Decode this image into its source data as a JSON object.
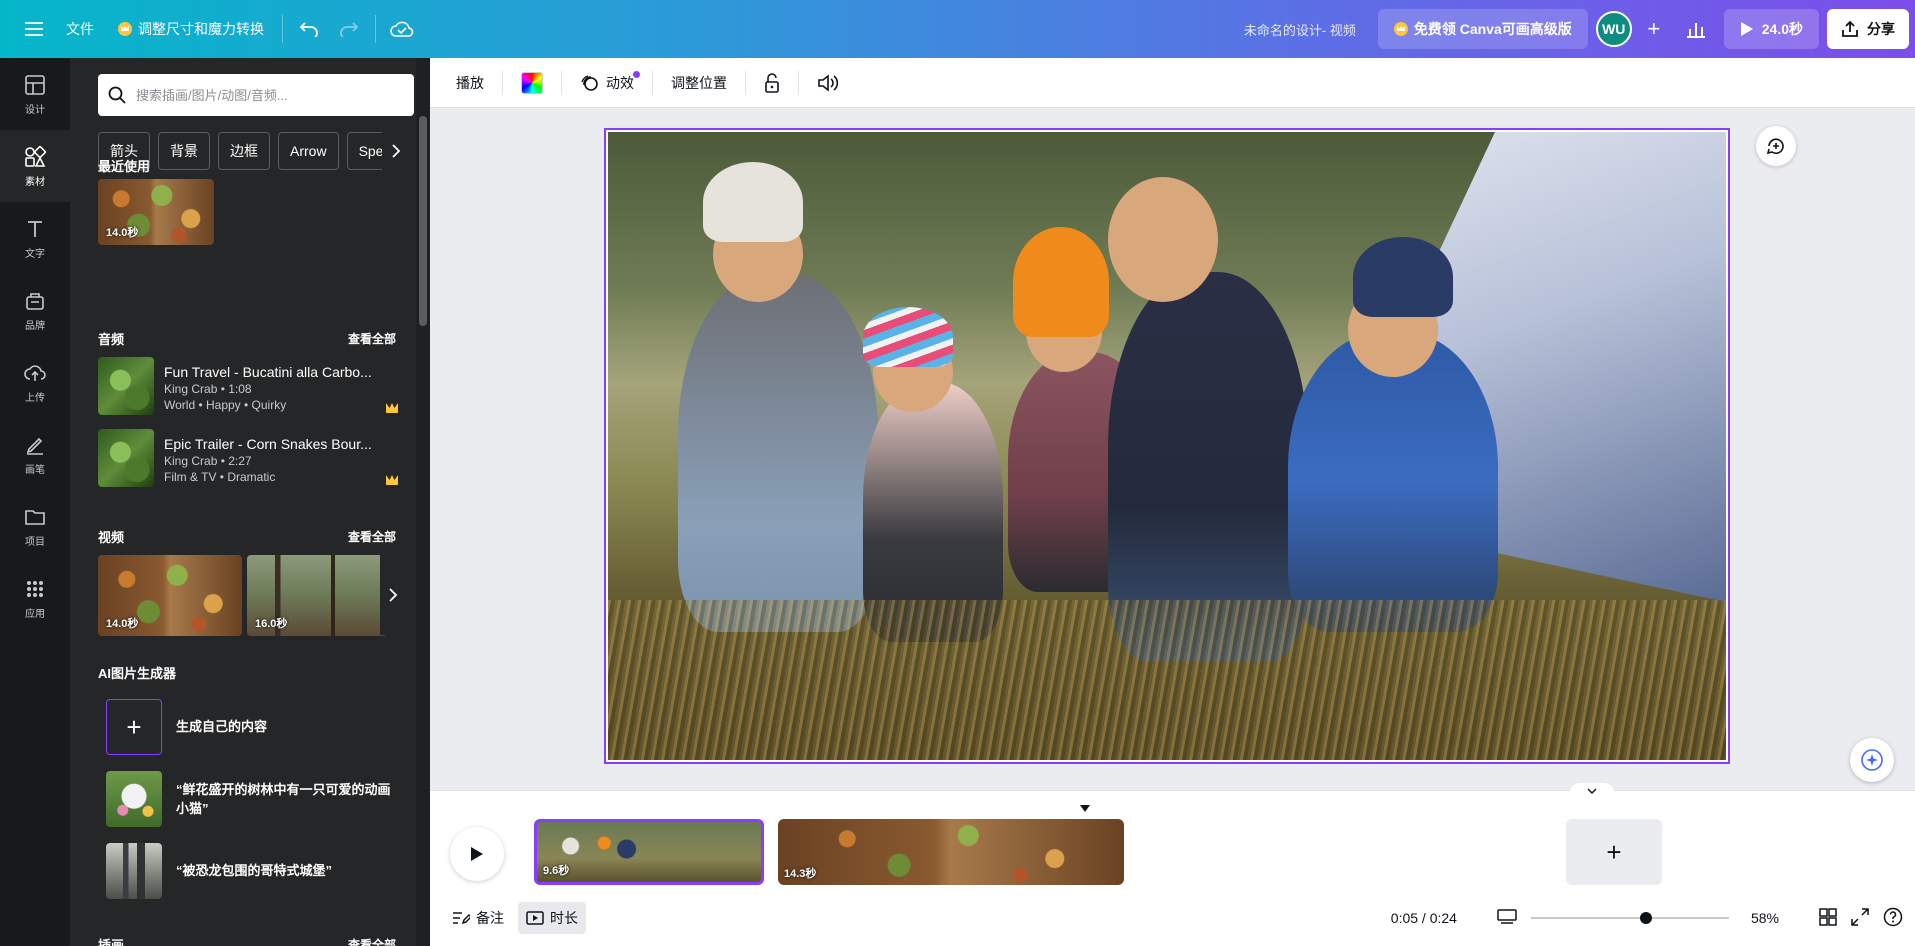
{
  "topbar": {
    "menu_icon": "hamburger-icon",
    "file_label": "文件",
    "resize_label": "调整尺寸和魔力转换",
    "design_name": "未命名的设计- 视频",
    "upgrade_label": "免费领 Canva可画高级版",
    "avatar_initials": "WU",
    "play_duration": "24.0秒",
    "share_label": "分享"
  },
  "rail": {
    "items": [
      {
        "label": "设计",
        "icon": "layout-icon"
      },
      {
        "label": "素材",
        "icon": "shapes-icon"
      },
      {
        "label": "文字",
        "icon": "text-icon"
      },
      {
        "label": "品牌",
        "icon": "brand-icon"
      },
      {
        "label": "上传",
        "icon": "upload-icon"
      },
      {
        "label": "画笔",
        "icon": "draw-icon"
      },
      {
        "label": "项目",
        "icon": "folder-icon"
      },
      {
        "label": "应用",
        "icon": "apps-icon"
      }
    ]
  },
  "panel": {
    "search_placeholder": "搜索插画/图片/动图/音频...",
    "chips": [
      "箭头",
      "背景",
      "边框",
      "Arrow",
      "Spe"
    ],
    "recent": {
      "title": "最近使用",
      "items": [
        {
          "duration": "14.0秒"
        }
      ]
    },
    "audio": {
      "title": "音频",
      "see_all": "查看全部",
      "items": [
        {
          "title": "Fun Travel - Bucatini alla Carbo...",
          "meta1": "King Crab • 1:08",
          "meta2": "World • Happy • Quirky"
        },
        {
          "title": "Epic Trailer - Corn Snakes Bour...",
          "meta1": "King Crab • 2:27",
          "meta2": "Film & TV • Dramatic"
        }
      ]
    },
    "video": {
      "title": "视频",
      "see_all": "查看全部",
      "items": [
        {
          "duration": "14.0秒"
        },
        {
          "duration": "16.0秒"
        }
      ]
    },
    "ai": {
      "title": "AI图片生成器",
      "create_label": "生成自己的内容",
      "prompts": [
        "“鲜花盛开的树林中有一只可爱的动画小猫”",
        "“被恐龙包围的哥特式城堡”"
      ]
    },
    "illustrations": {
      "title": "插画",
      "see_all": "查看全部"
    }
  },
  "editbar": {
    "play_label": "播放",
    "animate_label": "动效",
    "position_label": "调整位置"
  },
  "timeline": {
    "clips": [
      {
        "duration": "9.6秒"
      },
      {
        "duration": "14.3秒"
      }
    ]
  },
  "footer": {
    "notes_label": "备注",
    "duration_label": "时长",
    "time": "0:05 / 0:24",
    "zoom": "58%",
    "zoom_fraction": 0.58
  },
  "colors": {
    "accent": "#8b3dff",
    "panel_bg": "#252627",
    "rail_bg": "#18191b",
    "crown": "#ffc53d"
  }
}
